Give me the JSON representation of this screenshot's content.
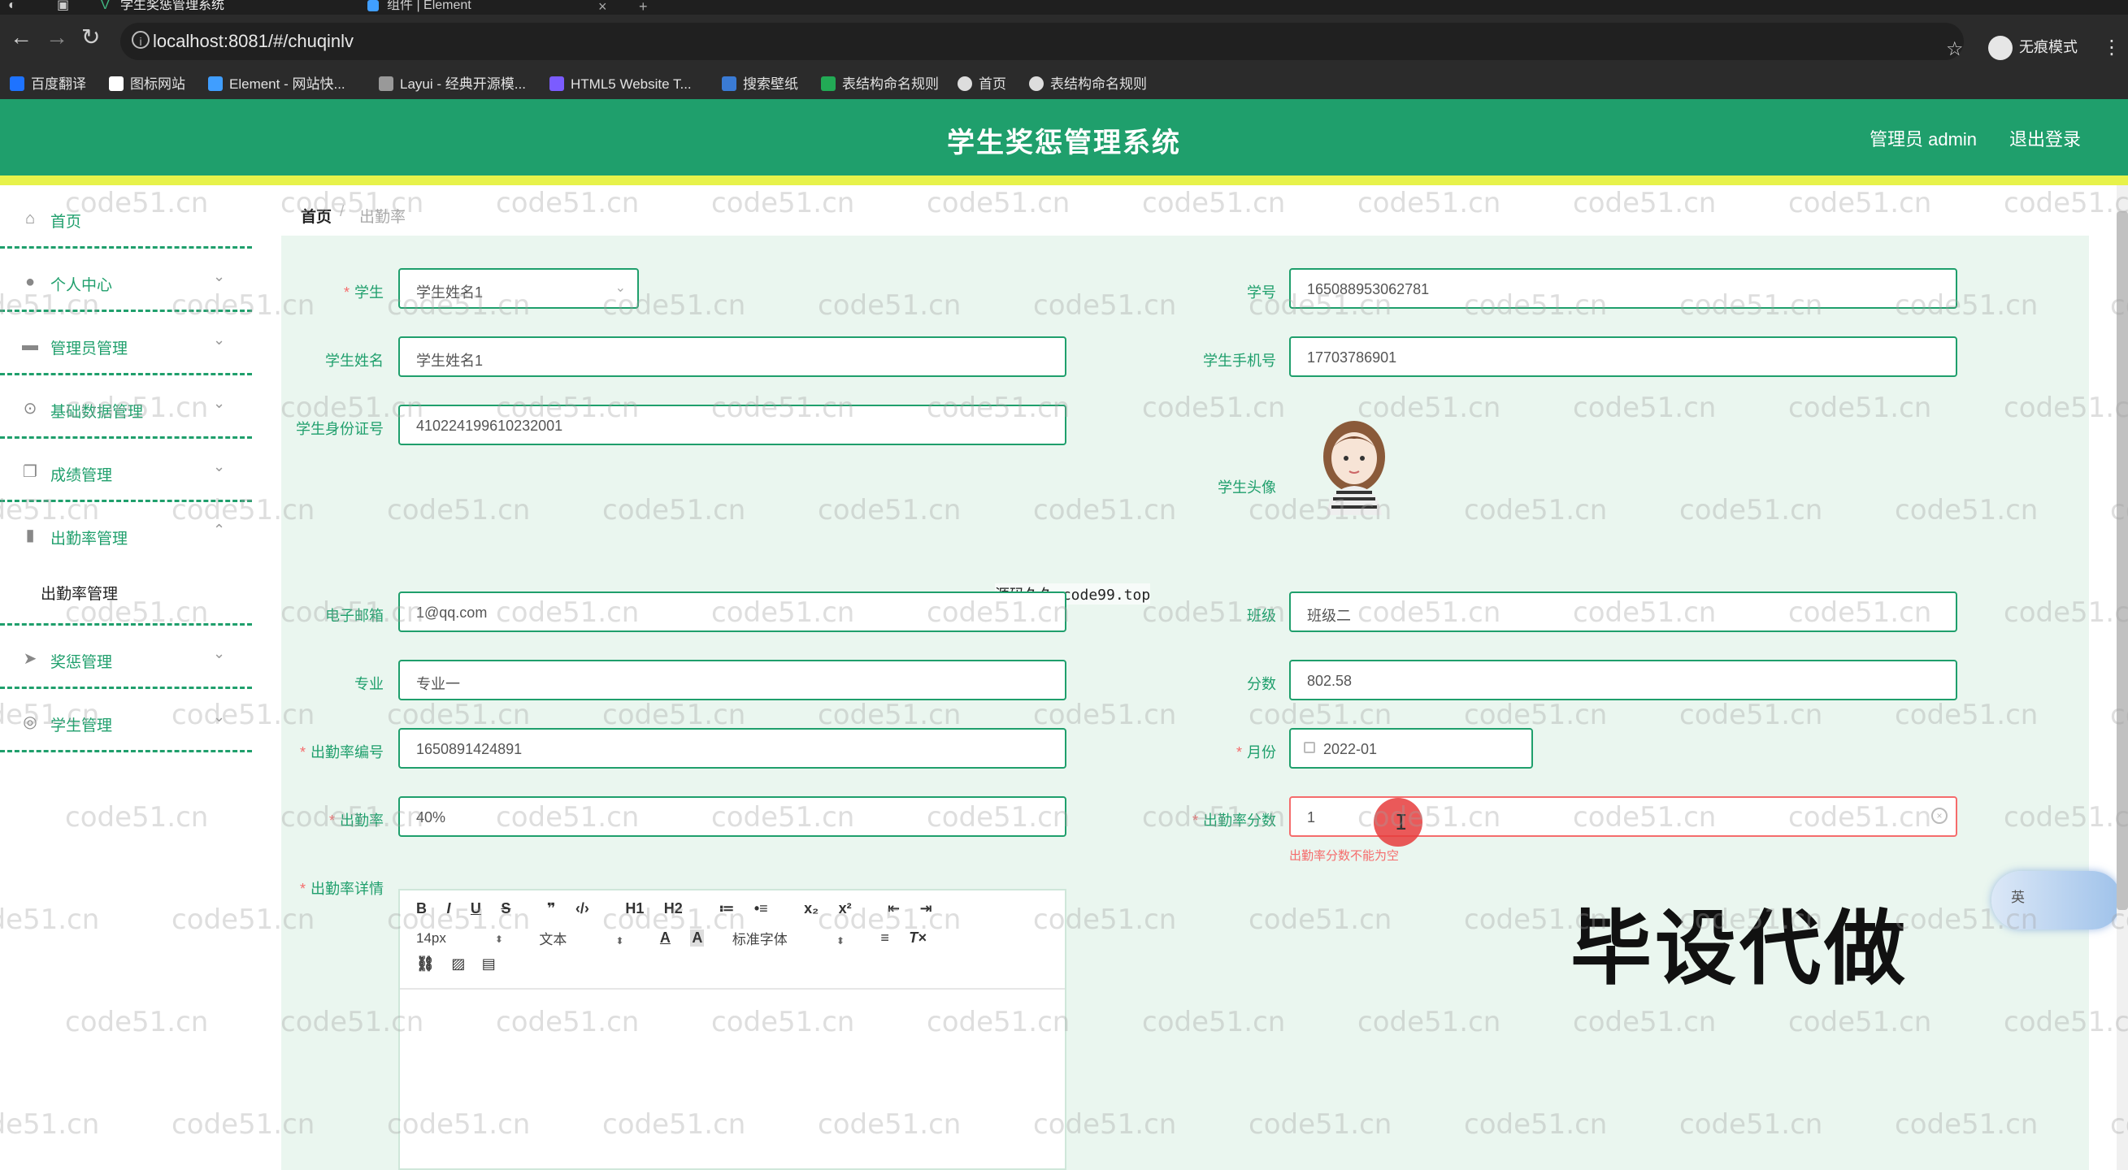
{
  "browser": {
    "tabs": [
      {
        "title": "学生奖惩管理系统",
        "active": true
      },
      {
        "title": "组件 | Element",
        "active": false
      }
    ],
    "url": "localhost:8081/#/chuqinlv",
    "profile_label": "无痕模式",
    "bookmarks": [
      {
        "label": "百度翻译",
        "icon_color": "#1e73ff"
      },
      {
        "label": "图标网站",
        "icon_color": "#ffffff"
      },
      {
        "label": "Element - 网站快...",
        "icon_color": "#409eff"
      },
      {
        "label": "Layui - 经典开源模...",
        "icon_color": "#999999"
      },
      {
        "label": "HTML5 Website T...",
        "icon_color": "#7b5cff"
      },
      {
        "label": "搜索壁纸",
        "icon_color": "#3a7bd5"
      },
      {
        "label": "表结构命名规则",
        "icon_color": "#22aa55"
      },
      {
        "label": "首页",
        "icon_color": "#dddddd"
      },
      {
        "label": "表结构命名规则",
        "icon_color": "#dddddd"
      }
    ]
  },
  "header": {
    "title": "学生奖惩管理系统",
    "admin_label": "管理员 admin",
    "logout_label": "退出登录",
    "brand_color": "#1f9f6c"
  },
  "sidebar": {
    "items": [
      {
        "label": "首页",
        "icon": "home-icon"
      },
      {
        "label": "个人中心",
        "icon": "user-icon"
      },
      {
        "label": "管理员管理",
        "icon": "chat-icon"
      },
      {
        "label": "基础数据管理",
        "icon": "microphone-icon"
      },
      {
        "label": "成绩管理",
        "icon": "copy-icon"
      },
      {
        "label": "出勤率管理",
        "icon": "bar-chart-icon"
      },
      {
        "label": "奖惩管理",
        "icon": "send-icon"
      },
      {
        "label": "学生管理",
        "icon": "compass-icon"
      }
    ],
    "submenu_item": "出勤率管理"
  },
  "breadcrumb": {
    "home": "首页",
    "separator": "/",
    "current": "出勤率"
  },
  "form": {
    "student": {
      "label": "学生",
      "value": "学生姓名1"
    },
    "student_no": {
      "label": "学号",
      "value": "165088953062781"
    },
    "student_name": {
      "label": "学生姓名",
      "value": "学生姓名1"
    },
    "phone": {
      "label": "学生手机号",
      "value": "17703786901"
    },
    "id_card": {
      "label": "学生身份证号",
      "value": "410224199610232001"
    },
    "avatar_label": "学生头像",
    "email": {
      "label": "电子邮箱",
      "value": "1@qq.com"
    },
    "class_name": {
      "label": "班级",
      "value": "班级二"
    },
    "major": {
      "label": "专业",
      "value": "专业一"
    },
    "score": {
      "label": "分数",
      "value": "802.58"
    },
    "attendance_no": {
      "label": "出勤率编号",
      "value": "1650891424891"
    },
    "month": {
      "label": "月份",
      "value": "2022-01"
    },
    "attendance_rate": {
      "label": "出勤率",
      "value": "40%"
    },
    "attendance_score": {
      "label": "出勤率分数",
      "value": "1",
      "error": "出勤率分数不能为空"
    },
    "detail_label": "出勤率详情"
  },
  "editor": {
    "row1": [
      "B",
      "I",
      "U",
      "S",
      "❞",
      "‹/›",
      "H1",
      "H2",
      "≔",
      "•≡",
      "x₂",
      "x²",
      "⇤",
      "⇥"
    ],
    "font_size": "14px",
    "text_style": "文本",
    "font_family": "标准字体"
  },
  "overlay": {
    "center_note": "源码久久-code99.top",
    "promo_text": "毕设代做",
    "widget_label": "英",
    "watermark": "code51.cn"
  }
}
